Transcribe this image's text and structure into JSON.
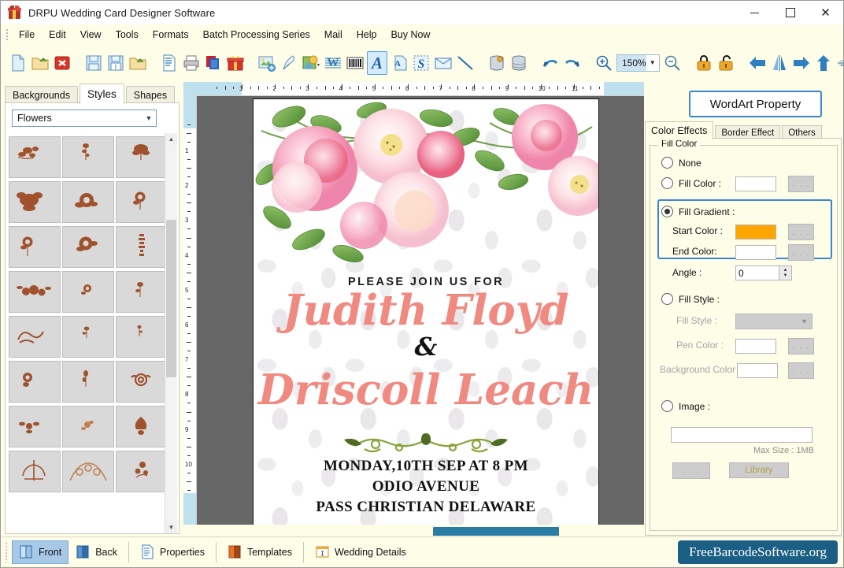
{
  "window": {
    "title": "DRPU Wedding Card Designer Software",
    "minimize": "—",
    "maximize": "□",
    "close": "✕"
  },
  "menu": {
    "items": [
      {
        "label": "File"
      },
      {
        "label": "Edit"
      },
      {
        "label": "View"
      },
      {
        "label": "Tools"
      },
      {
        "label": "Formats"
      },
      {
        "label": "Batch Processing Series"
      },
      {
        "label": "Mail"
      },
      {
        "label": "Help"
      },
      {
        "label": "Buy Now"
      }
    ]
  },
  "toolbar": {
    "zoom_value": "150%",
    "buttons": [
      {
        "name": "new-document-icon"
      },
      {
        "name": "open-folder-icon"
      },
      {
        "name": "close-document-icon"
      },
      {
        "name": "save-icon"
      },
      {
        "name": "save-as-icon"
      },
      {
        "name": "export-folder-icon"
      },
      {
        "name": "page-setup-icon"
      },
      {
        "name": "print-icon"
      },
      {
        "name": "card-layers-icon"
      },
      {
        "name": "gift-icon"
      },
      {
        "name": "insert-image-icon"
      },
      {
        "name": "pen-icon"
      },
      {
        "name": "shape-picture-icon"
      },
      {
        "name": "watermark-icon"
      },
      {
        "name": "barcode-icon"
      },
      {
        "name": "wordart-icon"
      },
      {
        "name": "text-icon"
      },
      {
        "name": "signature-icon"
      },
      {
        "name": "envelope-icon"
      },
      {
        "name": "line-icon"
      },
      {
        "name": "database-settings-icon"
      },
      {
        "name": "database-icon"
      },
      {
        "name": "undo-icon"
      },
      {
        "name": "redo-icon"
      },
      {
        "name": "zoom-in-icon"
      },
      {
        "name": "zoom-out-icon"
      },
      {
        "name": "lock-icon"
      },
      {
        "name": "unlock-icon"
      },
      {
        "name": "align-left-icon"
      },
      {
        "name": "flip-horizontal-icon"
      },
      {
        "name": "align-right-icon"
      },
      {
        "name": "align-top-icon"
      },
      {
        "name": "flip-vertical-icon"
      },
      {
        "name": "align-bottom-icon"
      }
    ]
  },
  "left_panel": {
    "tabs": [
      {
        "label": "Backgrounds",
        "active": false
      },
      {
        "label": "Styles",
        "active": true
      },
      {
        "label": "Shapes",
        "active": false
      }
    ],
    "category": "Flowers",
    "gallery_items": [
      "flower-spray-1",
      "flower-sprig-2",
      "rose-bud-3",
      "rose-corner-4",
      "rose-bloom-5",
      "rose-small-6",
      "rose-stem-7",
      "rose-open-8",
      "floral-border-9",
      "floral-cluster-10",
      "small-bloom-11",
      "rose-sprig-12",
      "ribbon-flourish-13",
      "tiny-sprig-14",
      "thin-sprig-15",
      "rose-scroll-16",
      "vine-sprig-17",
      "rose-leaf-18",
      "floral-spray-19",
      "petal-cluster-20",
      "ornament-21",
      "filigree-fan-22",
      "floral-arch-23",
      "berry-flower-24"
    ]
  },
  "canvas": {
    "h_ruler_labels": [
      "1",
      "2",
      "3",
      "4",
      "5",
      "6",
      "7",
      "8",
      "9",
      "10",
      "11"
    ],
    "v_ruler_labels": [
      "1",
      "2",
      "3",
      "4",
      "5",
      "6",
      "7",
      "8",
      "9",
      "10"
    ],
    "card": {
      "intro": "PLEASE JOIN US FOR",
      "name1": "Judith Floyd",
      "ampersand": "&",
      "name2": "Driscoll Leach",
      "detail_line1": "MONDAY,10TH SEP AT 8 PM",
      "detail_line2": "ODIO AVENUE",
      "detail_line3": "PASS CHRISTIAN DELAWARE"
    }
  },
  "right_panel": {
    "title": "WordArt Property",
    "tabs": [
      {
        "label": "Color Effects",
        "active": true
      },
      {
        "label": "Border Effect",
        "active": false
      },
      {
        "label": "Others",
        "active": false
      }
    ],
    "group_label": "Fill Color",
    "options": {
      "none_label": "None",
      "fill_color_label": "Fill Color :",
      "fill_gradient_label": "Fill Gradient :",
      "start_color_label": "Start Color :",
      "end_color_label": "End Color:",
      "angle_label": "Angle :",
      "angle_value": "0",
      "fill_style_radio_label": "Fill Style :",
      "fill_style_label": "Fill Style :",
      "pen_color_label": "Pen Color :",
      "background_color_label": "Background Color :",
      "image_label": "Image :",
      "max_size": "Max Size : 1MB",
      "library_button": "Library",
      "browse_button": ". . .",
      "image_path": ""
    },
    "colors": {
      "start_color": "#ffa500",
      "end_color": "#ffffff",
      "fill_color": "#ffffff",
      "pen_color": "#ffffff",
      "background_color": "#ffffff",
      "highlight_border": "#3a86d4"
    },
    "selected_fill_mode": "fill_gradient"
  },
  "bottom_bar": {
    "buttons": [
      {
        "label": "Front",
        "icon": "book-front-icon",
        "active": true
      },
      {
        "label": "Back",
        "icon": "book-back-icon",
        "active": false
      },
      {
        "label": "Properties",
        "icon": "properties-icon",
        "active": false
      },
      {
        "label": "Templates",
        "icon": "templates-icon",
        "active": false
      },
      {
        "label": "Wedding Details",
        "icon": "wedding-details-icon",
        "active": false
      }
    ],
    "brand": "FreeBarcodeSoftware.org"
  }
}
